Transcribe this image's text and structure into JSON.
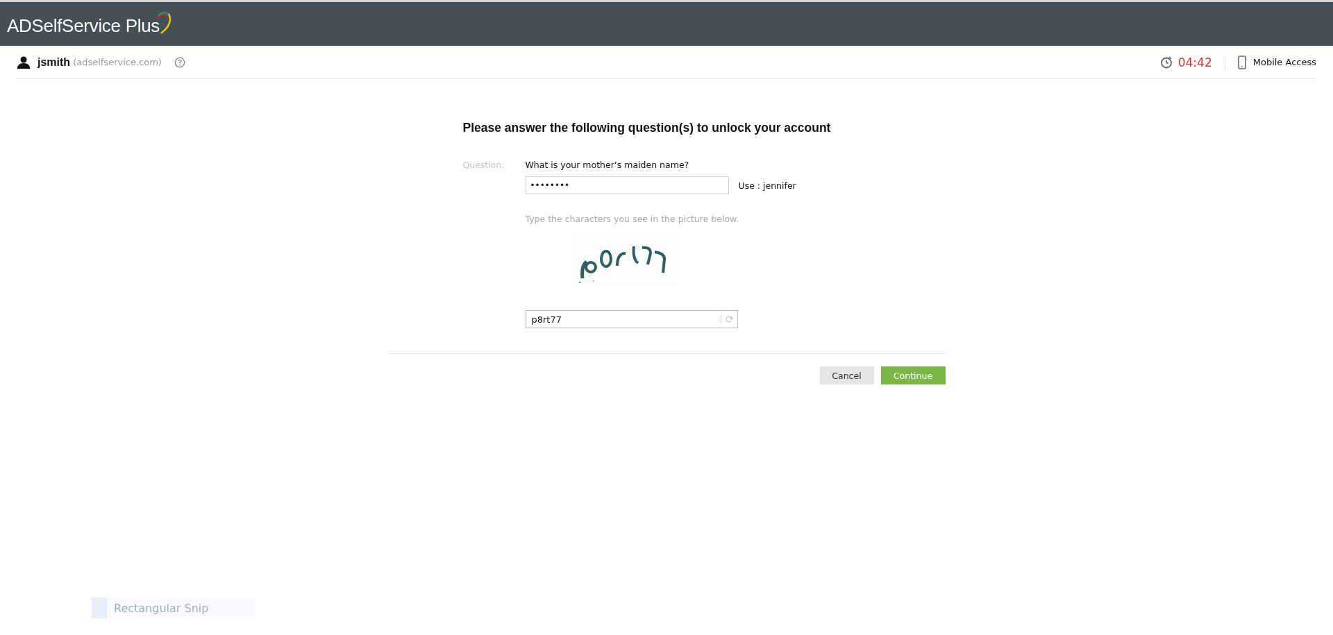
{
  "header": {
    "logo": "ADSelfService Plus"
  },
  "user_bar": {
    "username": "jsmith",
    "domain": "(adselfservice.com)",
    "timer": "04:42",
    "mobile_link": "Mobile Access"
  },
  "form": {
    "title": "Please answer the following question(s) to unlock your account",
    "question_label": "Question:",
    "question": "What is your mother’s maiden name?",
    "answer_value": "••••••••",
    "answer_hint": "Use : jennifer",
    "captcha_instruction": "Type the characters you see in the picture below.",
    "captcha_value": "p8rt77",
    "buttons": [
      {
        "label": "Cancel",
        "kind": "secondary"
      },
      {
        "label": "Continue",
        "kind": "primary"
      }
    ]
  },
  "snip_tooltip": {
    "label": "Rectangular Snip"
  }
}
